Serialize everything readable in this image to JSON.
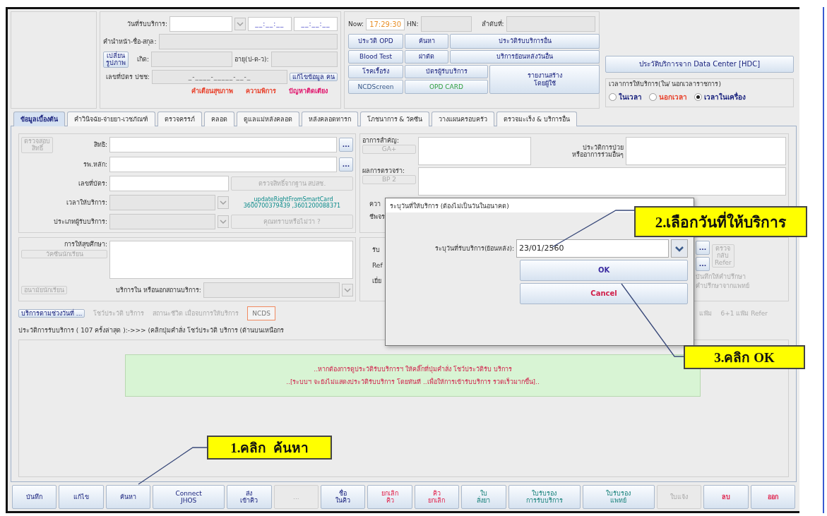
{
  "patient": {
    "visit_date_label": "วันที่รับบริการ:",
    "time_masks": [
      "__:__:__",
      "__:__:__"
    ],
    "name_label": "คำนำหน้า-ชื่อ-สกุล:",
    "change_photo_button": "เปลี่ยน\nรูปภาพ",
    "birth_label": "เกิด:",
    "age_label": "อายุ(ป-ด-ว):",
    "id_label": "เลขที่บัตร ปชช:",
    "id_mask": "_-____-_____-__-_",
    "edit_person_button": "แก้ไขข้อมูล คน",
    "alerts": [
      {
        "label": "คำเตือนสุขภาพ",
        "color": "#e8402a"
      },
      {
        "label": "ความพิการ",
        "color": "#e8402a"
      },
      {
        "label": "ปัญหาติดเตียง",
        "color": "#e0106a"
      }
    ]
  },
  "visit": {
    "now_label": "Now:",
    "now_time": "17:29:30",
    "hn_label": "HN:",
    "order_label": "ลำดับที่:",
    "buttons": [
      "ประวัติ OPD",
      "ค้นหา",
      "ประวัติรับบริการอื่น",
      "Blood Test",
      "ผ่าตัด",
      "บริการย้อนหลังวันอื่น",
      "โรคเรื้อรัง",
      "NCDScreen",
      "บัตรผู้รับบริการ",
      "OPD CARD",
      "รายงานสร้าง\nโดยผู้ใช้"
    ]
  },
  "hdc_button": "ประวัติบริการจาก Data Center [HDC]",
  "service_time": {
    "legend": "เวลาการให้บริการ(ใน/ นอกเวลาราชการ)",
    "options": [
      {
        "label": "ในเวลา",
        "selected": false,
        "color": "#1a237e"
      },
      {
        "label": "นอกเวลา",
        "selected": false,
        "color": "#e8402a"
      },
      {
        "label": "เวลาในเครื่อง",
        "selected": true,
        "color": "#1a237e"
      }
    ]
  },
  "tabs": [
    {
      "label": "ข้อมูลเบื้องต้น",
      "selected": true
    },
    {
      "label": "คำวินิจฉัย-จ่ายยา-เวชภัณฑ์",
      "selected": false
    },
    {
      "label": "ตรวจครรภ์",
      "selected": false
    },
    {
      "label": "คลอด",
      "selected": false
    },
    {
      "label": "ดูแลแม่หลังคลอด",
      "selected": false
    },
    {
      "label": "หลังคลอดทารก",
      "selected": false
    },
    {
      "label": "โภชนาการ & วัคซีน",
      "selected": false
    },
    {
      "label": "วางแผนครอบครัว",
      "selected": false
    },
    {
      "label": "ตรวจมะเร็ง & บริการอื่น",
      "selected": false
    }
  ],
  "rights": {
    "check_button": {
      "label": "ตรวจสอบ\nสิทธิ์",
      "disabled": true
    },
    "right_label": "สิทธิ:",
    "hospital_label": "รพ.หลัก:",
    "browse_buttons": [
      "...",
      "..."
    ],
    "card_label": "เลขที่บัตร:",
    "nhso_button": {
      "label": "ตรวจสิทธิ์จากฐาน สปสช.",
      "disabled": true
    },
    "service_time_label": "เวลาให้บริการ:",
    "smartcard_note": "_updateRightFromSmartCard\n3600700379439 ,3601200088371",
    "client_type_label": "ประเภทผู้รับบริการ:",
    "tip_button": {
      "label": "คุณทราบหรือไม่ว่า ?",
      "disabled": true
    }
  },
  "symptoms": {
    "chief_complaint_label": "อาการสำคัญ:",
    "ga_button": {
      "label": "GA+",
      "disabled": true
    },
    "history_label": "ประวัติการป่วย\nหรืออาการร่วมอื่นๆ",
    "exam_label": "ผลการตรวจร่า:",
    "bp_button": {
      "label": "BP 2",
      "disabled": true
    },
    "vital_labels": [
      "ควา",
      "ชีพจร"
    ]
  },
  "education": {
    "label": "การให้สุขศึกษา:",
    "student_buttons": [
      {
        "label": "วัคซีนนักเรียน",
        "disabled": true
      },
      {
        "label": "อนามัยนักเรียน",
        "disabled": true
      }
    ],
    "place_label": "บริการใน หรือนอกสถานบริการ:"
  },
  "referral": {
    "labels": [
      "รับ",
      "Ref",
      "เยี่ย"
    ],
    "browse_buttons": [
      "...",
      "..."
    ],
    "refer_back_button": {
      "label": "ตรวจ\nกลับ\nRefer",
      "disabled": true
    },
    "consult_notes": [
      "บันทึกให้คำปรึกษา",
      "คำปรึกษาจากแพทย์"
    ]
  },
  "actions": {
    "date_range_button": "บริการตามช่วงวันที่ ...",
    "show_history_link": {
      "label": "โชว์ประวัติ บริการ",
      "disabled": true
    },
    "life_status_label": {
      "label": "สถานะชีวิต เมื่อจบการให้บริการ",
      "disabled": true
    },
    "ncds_button": "NCDS",
    "file_label": "แฟ้ม",
    "refer_file_label": "6+1 แฟ้ม Refer"
  },
  "history": {
    "summary": "ประวัติการรับบริการ ( 107 ครั้งล่าสุด ):->>> (คลิกปุ่มคำสั่ง โชว์ประวัติ บริการ (ด้านบนเหนือกร",
    "notice": [
      "..หากต้องการดูประวัติรับบริการฯ ให้คลิ๊กที่ปุ่มคำสั่ง โชว์ประวัติรับ บริการ",
      "..[ระบบฯ จะยังไม่แสดงประวัติรับบริการ โดยทันที ..เพื่อให้การเข้ารับบริการ รวดเร็วมากขึ้น].."
    ]
  },
  "toolbar": [
    {
      "label": "บันทึก",
      "disabled": false
    },
    {
      "label": "แก้ไข",
      "disabled": false
    },
    {
      "label": "ค้นหา",
      "disabled": false
    },
    {
      "label": "Connect\nJHOS",
      "disabled": false
    },
    {
      "label": "ส่ง\nเข้าคิว",
      "disabled": false
    },
    {
      "label": "...",
      "disabled": true
    },
    {
      "label": "ชื่อ\nในคิว",
      "disabled": false
    },
    {
      "label": "ยกเลิก\nคิว",
      "disabled": false
    },
    {
      "label": "คิว\nยกเลิก",
      "disabled": false
    },
    {
      "label": "ใบ\nสั่งยา",
      "disabled": false
    },
    {
      "label": "ใบรับรอง\nการรับบริการ",
      "disabled": false
    },
    {
      "label": "ใบรับรอง\nแพทย์",
      "disabled": false
    },
    {
      "label": "ใบแจ้ง",
      "disabled": true
    },
    {
      "label": "ลบ",
      "disabled": false
    },
    {
      "label": "ออก",
      "disabled": false
    }
  ],
  "dialog": {
    "title": "ระบุวันที่ให้บริการ (ต้องไม่เป็นวันในอนาคต)",
    "date_label": "ระบุวันที่รับบริการ(ย้อนหลัง):",
    "date_value": "23/01/2560",
    "ok_button": "OK",
    "cancel_button": "Cancel"
  },
  "callouts": [
    "2.เลือกวันที่ให้บริการ",
    "3.คลิก OK",
    "1.คลิก  ค้นหา"
  ]
}
